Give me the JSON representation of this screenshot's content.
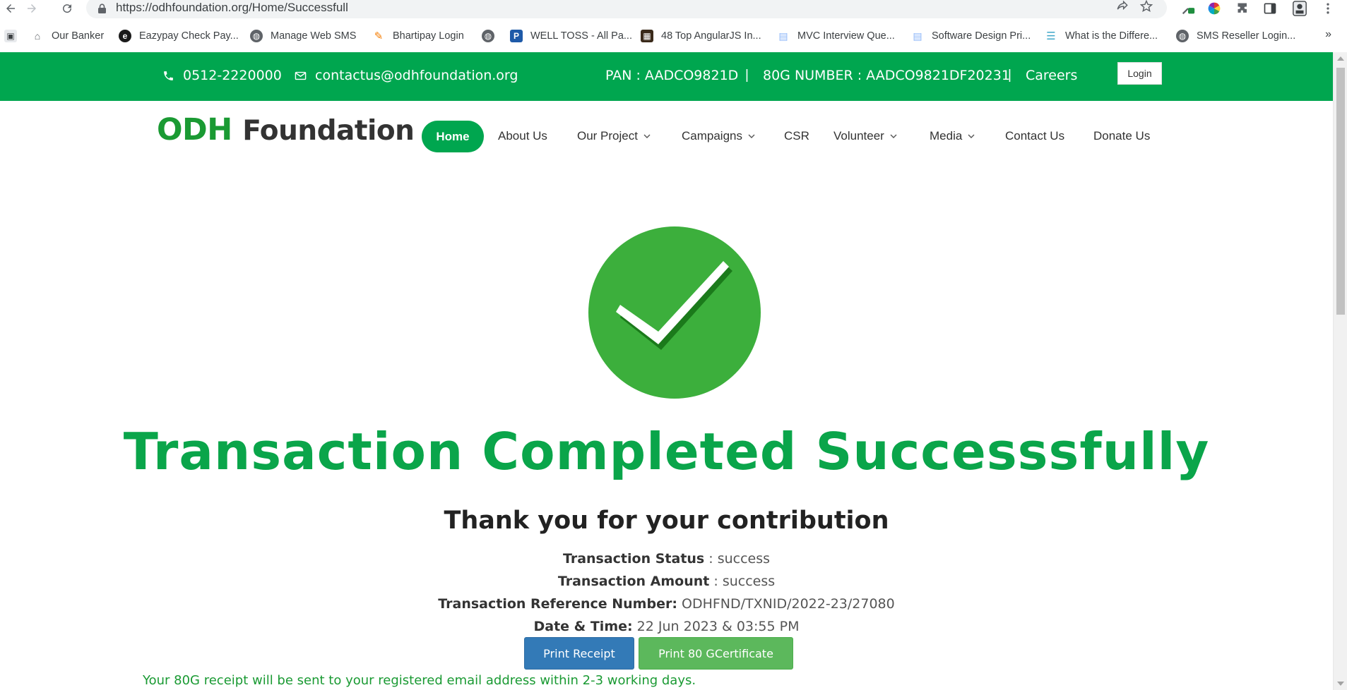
{
  "browser": {
    "url": "https://odhfoundation.org/Home/Successfull",
    "bookmarks": [
      {
        "label": "Our Banker",
        "icon": "bank-icon",
        "color": "#5f6368"
      },
      {
        "label": "Eazypay Check Pay...",
        "icon": "eazypay-icon",
        "color": "#1a1a1a"
      },
      {
        "label": "Manage Web SMS",
        "icon": "globe-icon",
        "color": "#5f6368"
      },
      {
        "label": "Bhartipay Login",
        "icon": "bhartipay-icon",
        "color": "#f57c00"
      },
      {
        "label": "",
        "icon": "globe-icon",
        "color": "#5f6368"
      },
      {
        "label": "WELL TOSS - All Pa...",
        "icon": "p-icon",
        "color": "#1e5aa8"
      },
      {
        "label": "48 Top AngularJS In...",
        "icon": "book-icon",
        "color": "#3a2a1a"
      },
      {
        "label": "MVC Interview Que...",
        "icon": "mvc-icon",
        "color": "#8ab4f8"
      },
      {
        "label": "Software Design Pri...",
        "icon": "design-icon",
        "color": "#8ab4f8"
      },
      {
        "label": "What is the Differe...",
        "icon": "list-icon",
        "color": "#3fa7c9"
      },
      {
        "label": "SMS Reseller Login...",
        "icon": "globe-icon",
        "color": "#5f6368"
      }
    ],
    "more": "»"
  },
  "topbar": {
    "phone": "0512-2220000",
    "email": "contactus@odhfoundation.org",
    "pan": "PAN : AADCO9821D",
    "sep1": "|",
    "g80": "80G NUMBER : AADCO9821DF20231",
    "sep2": "|",
    "careers": "Careers",
    "login": "Login"
  },
  "nav": {
    "logo_odh": "ODH",
    "logo_foundation": "Foundation",
    "home": "Home",
    "about": "About Us",
    "project": "Our Project",
    "campaigns": "Campaigns",
    "csr": "CSR",
    "volunteer": "Volunteer",
    "media": "Media",
    "contact": "Contact Us",
    "donate": "Donate Us"
  },
  "main": {
    "headline": "Transaction Completed Successsfully",
    "thanks": "Thank you for your contribution",
    "status_label": "Transaction Status",
    "status_value": ": success",
    "amount_label": "Transaction Amount",
    "amount_value": ": success",
    "ref_label": "Transaction Reference Number:",
    "ref_value": "ODHFND/TXNID/2022-23/27080",
    "date_label": "Date & Time:",
    "date_value": "22 Jun 2023 & 03:55 PM",
    "print_receipt": "Print Receipt",
    "print_cert": "Print 80 GCertificate",
    "note": "Your 80G receipt will be sent to your registered email address within 2-3 working days."
  },
  "colors": {
    "brand_green": "#00a64f",
    "headline_green": "#0aa54a",
    "check_green": "#3caf3c",
    "primary_blue": "#337ab7",
    "success_green": "#5cb85c"
  }
}
